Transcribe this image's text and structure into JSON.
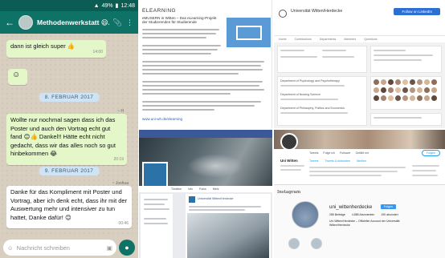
{
  "whatsapp": {
    "status": {
      "battery": "49%",
      "time": "12:48"
    },
    "title": "Methodenwerkstatt 😄...",
    "messages": [
      {
        "text": "dann ist gleich super 👍",
        "time": "14:00",
        "dir": "out"
      },
      {
        "text": "☺",
        "time": "",
        "dir": "out"
      },
      {
        "date": "8. FEBRUAR 2017"
      },
      {
        "text": "Wollte nur nochmal sagen dass ich das Poster und auch den Vortrag echt gut fand 😊👍 Dankel!! Hätte echt nicht gedacht, dass wir das alles noch so gut hinbekommen 😂",
        "time": "20:19",
        "dir": "out",
        "sender": "~ H"
      },
      {
        "date": "9. FEBRUAR 2017"
      },
      {
        "text": "Danke für das Kompliment mit Poster und Vortrag, aber ich denk echt, dass ihr mit der Auswertung mehr und intensiver zu tun hattet, Danke dafür! 😊",
        "time": "00:46",
        "dir": "in",
        "sender": "~ Joshua"
      }
    ],
    "input_placeholder": "Nachricht schreiben"
  },
  "doc": {
    "heading": "ELEARNING",
    "intro": "eMUSERN in Witten – Das eLearning-Projekt der Studierenden für Studierende",
    "link": "www.uni-wh.de/elearning"
  },
  "uni": {
    "name": "Universität Witten/Herdecke",
    "button": "Follow on LinkedIn",
    "tabs": [
      "Home",
      "Contributions",
      "Departments",
      "Members",
      "Questions"
    ],
    "departments": [
      "Department of Psychology and Psychotherapy",
      "Department of Nursing Science",
      "Department of Philosophy, Politics and Economics"
    ]
  },
  "facebook": {
    "page_name": "Universität Witten/Herdecke",
    "nav": [
      "Timeline",
      "Info",
      "Fotos",
      "Mehr"
    ]
  },
  "twitter": {
    "name": "Uni Witten",
    "stats": [
      "Tweets",
      "Folge ich",
      "Follower",
      "Gefällt mir"
    ],
    "tabs": [
      "Tweets",
      "Tweets & Antworten",
      "Medien"
    ],
    "follow_label": "Folgen"
  },
  "instagram": {
    "header": "Instagram",
    "username": "uni_wittenherdecke",
    "follow_label": "Folgen",
    "stats": [
      "285 Beiträge",
      "4.885 Abonnenten",
      "190 abonniert"
    ],
    "bio": "Uni Witten/Herdecke – Offizieller Account der Universität Witten/Herdecke"
  }
}
